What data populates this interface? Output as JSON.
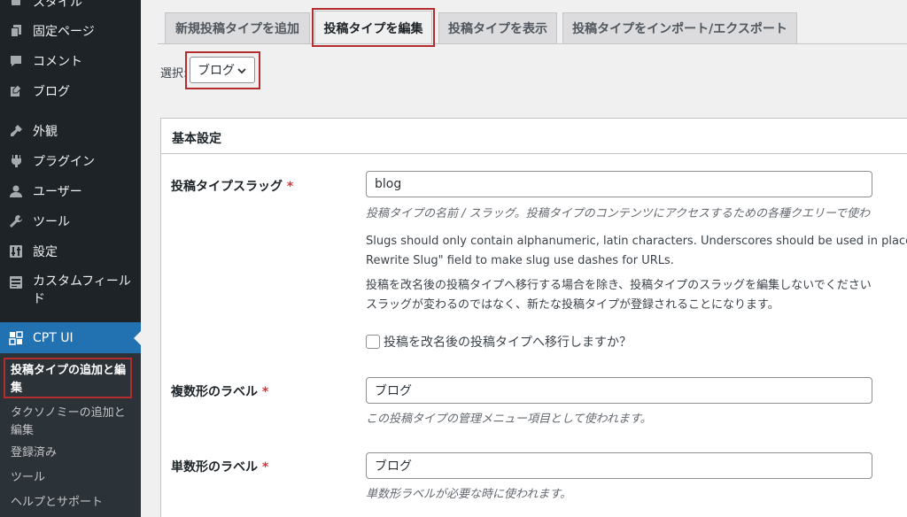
{
  "sidebar": {
    "items": [
      {
        "label": "スタイル",
        "icon": "style-icon"
      },
      {
        "label": "固定ページ",
        "icon": "pages-icon"
      },
      {
        "label": "コメント",
        "icon": "comments-icon"
      },
      {
        "label": "ブログ",
        "icon": "blog-icon"
      },
      {
        "label": "外観",
        "icon": "appearance-icon"
      },
      {
        "label": "プラグイン",
        "icon": "plugins-icon"
      },
      {
        "label": "ユーザー",
        "icon": "users-icon"
      },
      {
        "label": "ツール",
        "icon": "tools-icon"
      },
      {
        "label": "設定",
        "icon": "settings-icon"
      },
      {
        "label": "カスタムフィールド",
        "icon": "custom-fields-icon"
      },
      {
        "label": "CPT UI",
        "icon": "cptui-icon"
      }
    ],
    "submenu": [
      "投稿タイプの追加と編集",
      "タクソノミーの追加と編集",
      "登録済み",
      "ツール",
      "ヘルプとサポート"
    ]
  },
  "tabs": [
    "新規投稿タイプを追加",
    "投稿タイプを編集",
    "投稿タイプを表示",
    "投稿タイプをインポート/エクスポート"
  ],
  "selector": {
    "label": "選択:",
    "value": "ブログ"
  },
  "panel": {
    "title": "基本設定",
    "slug": {
      "label": "投稿タイプスラッグ",
      "required": "*",
      "value": "blog",
      "help": "投稿タイプの名前 / スラッグ。投稿タイプのコンテンツにアクセスするための各種クエリーで使わ",
      "desc": [
        "Slugs should only contain alphanumeric, latin characters. Underscores should be used in place of sp",
        "Rewrite Slug\" field to make slug use dashes for URLs.",
        "投稿を改名後の投稿タイプへ移行する場合を除き、投稿タイプのスラッグを編集しないでください",
        "スラッグが変わるのではなく、新たな投稿タイプが登録されることになります。"
      ],
      "migrate_checkbox": "投稿を改名後の投稿タイプへ移行しますか？"
    },
    "plural": {
      "label": "複数形のラベル",
      "required": "*",
      "value": "ブログ",
      "help": "この投稿タイプの管理メニュー項目として使われます。"
    },
    "singular": {
      "label": "単数形のラベル",
      "required": "*",
      "value": "ブログ",
      "help": "単数形ラベルが必要な時に使われます。"
    }
  }
}
